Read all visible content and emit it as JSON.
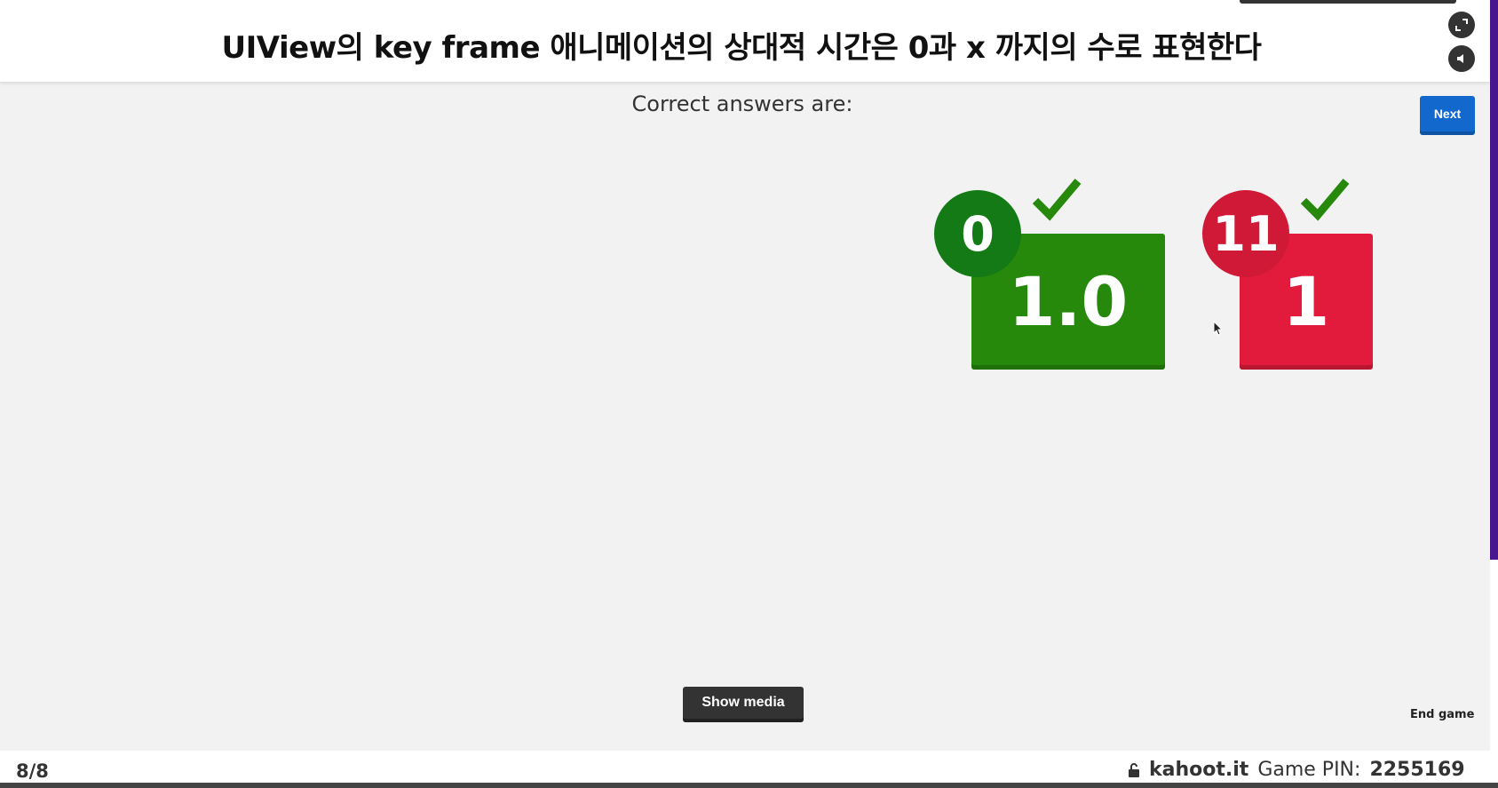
{
  "question": "UIView의 key frame 애니메이션의 상대적 시간은 0과 x 까지의 수로 표현한다",
  "subtitle": "Correct answers are:",
  "next_label": "Next",
  "answers": [
    {
      "count": "0",
      "text": "1.0",
      "color": "#26890c",
      "badge_color": "#137a15",
      "correct": true,
      "icon": "check-icon"
    },
    {
      "count": "11",
      "text": "1",
      "color": "#e21b3c",
      "badge_color": "#d01937",
      "correct": true,
      "icon": "check-icon"
    }
  ],
  "show_media_label": "Show media",
  "end_game_label": "End game",
  "footer": {
    "counter": "8/8",
    "site": "kahoot.it",
    "pin_label": "Game PIN:",
    "pin": "2255169"
  },
  "icons": [
    "fullscreen-icon",
    "sound-icon",
    "lock-icon",
    "check-icon"
  ]
}
